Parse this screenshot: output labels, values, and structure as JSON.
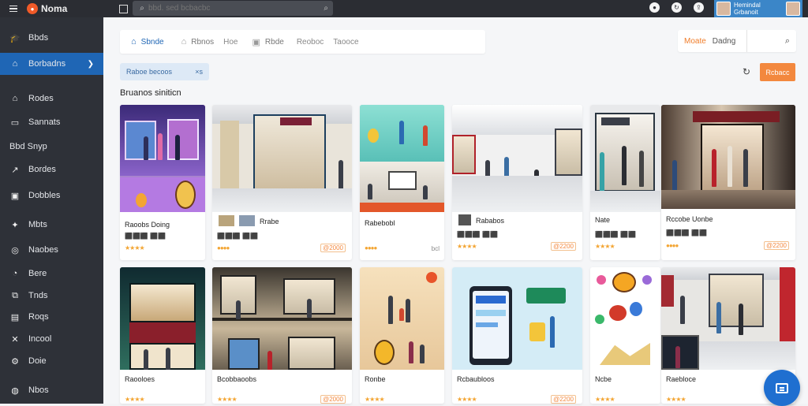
{
  "app": {
    "title": "Noma"
  },
  "search": {
    "placeholder": "bbd. sed bcbacbc"
  },
  "account": {
    "name": "Hemindal\nGrbanoit"
  },
  "sidebar": {
    "items": [
      {
        "label": "Bbds",
        "icon": "graduation-icon"
      },
      {
        "label": "Borbadns",
        "icon": "home-icon",
        "active": true
      },
      {
        "label": "Rodes",
        "icon": "home-icon"
      },
      {
        "label": "Sannats",
        "icon": "monitor-icon"
      },
      {
        "label": "Bbd Snyp",
        "icon": "none"
      },
      {
        "label": "Bordes",
        "icon": "chart-icon"
      },
      {
        "label": "Dobbles",
        "icon": "book-icon"
      },
      {
        "label": "Mbts",
        "icon": "twitter-icon"
      },
      {
        "label": "Naobes",
        "icon": "settings-icon"
      },
      {
        "label": "Bere",
        "icon": "clock-icon"
      },
      {
        "label": "Tnds",
        "icon": "stack-icon"
      },
      {
        "label": "Roqs",
        "icon": "bag-icon"
      },
      {
        "label": "Incool",
        "icon": "tool-icon"
      },
      {
        "label": "Doie",
        "icon": "gear-icon"
      },
      {
        "label": "Nbos",
        "icon": "help-icon"
      }
    ]
  },
  "tabs": [
    {
      "label": "Sbnde",
      "icon": "home-icon",
      "active": true
    },
    {
      "label": "Rbnos",
      "icon": "home-icon"
    },
    {
      "label": "Hoe",
      "icon": "none"
    },
    {
      "label": "Rbde",
      "icon": "cube-icon"
    },
    {
      "label": "Reoboc",
      "icon": "none"
    },
    {
      "label": "Taooce",
      "icon": "none"
    }
  ],
  "right_box": {
    "accent": "Moate",
    "label": "Dadng"
  },
  "chip": {
    "label": "Raboe becoos",
    "close": "×s"
  },
  "orange_button": "Rcbacc",
  "section_title": "Bruanos siniticn",
  "cards_row1": [
    {
      "caption": "Raoobs Doing",
      "meta": "⬛⬛⬛ ⬛⬛",
      "stars": "★★★★",
      "price": ""
    },
    {
      "caption": "Rrabe",
      "meta": "⬛⬛⬛ ⬛⬛",
      "stars": "●●●●",
      "price": "@2000"
    },
    {
      "caption": "Rabebobl",
      "meta": "",
      "stars": "●●●●",
      "price": "bcl"
    },
    {
      "caption": "Rababos",
      "meta": "⬛⬛⬛ ⬛⬛",
      "stars": "★★★★",
      "price": "@2200"
    },
    {
      "caption": "Nate",
      "meta": "⬛⬛⬛ ⬛⬛",
      "stars": "★★★★",
      "price": ""
    },
    {
      "caption": "Rccobe Uonbe",
      "meta": "⬛⬛⬛ ⬛⬛",
      "stars": "●●●●",
      "price": "@2200"
    }
  ],
  "cards_row2": [
    {
      "caption": "Raooloes",
      "stars": "★★★★"
    },
    {
      "caption": "Bcobbaoobs",
      "stars": "★★★★",
      "price": "@2000"
    },
    {
      "caption": "Ronbe",
      "stars": "★★★★",
      "price": ""
    },
    {
      "caption": "Rcbaubloos",
      "stars": "★★★★",
      "price": "@2200"
    },
    {
      "caption": "Ncbe",
      "stars": "★★★★",
      "price": ""
    },
    {
      "caption": "Raebloce",
      "stars": "★★★★",
      "price": ""
    }
  ],
  "colors": {
    "accent": "#1f66b5",
    "orange": "#f3883e",
    "sidebar": "#2e3138",
    "topbar": "#2b2d33"
  }
}
